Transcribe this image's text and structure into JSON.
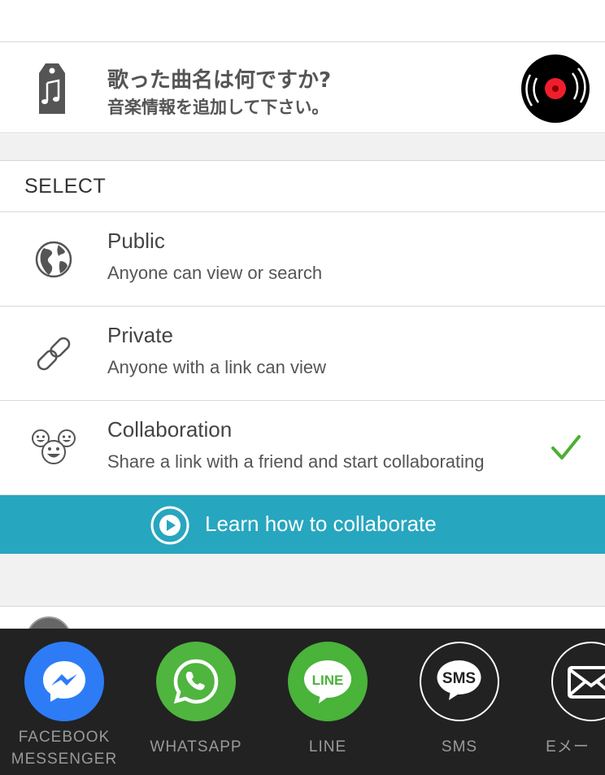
{
  "song": {
    "title": "歌った曲名は何ですか?",
    "subtitle": "音楽情報を追加して下さい。"
  },
  "select": {
    "label": "SELECT"
  },
  "options": [
    {
      "title": "Public",
      "description": "Anyone can view or search",
      "icon": "globe-icon",
      "selected": false
    },
    {
      "title": "Private",
      "description": "Anyone with a link can view",
      "icon": "link-icon",
      "selected": false
    },
    {
      "title": "Collaboration",
      "description": "Share a link with a friend and start collaborating",
      "icon": "smiley-group-icon",
      "selected": true
    }
  ],
  "learn": {
    "label": "Learn how to collaborate"
  },
  "share": {
    "items": [
      {
        "label_line1": "FACEBOOK",
        "label_line2": "MESSENGER",
        "icon": "messenger-icon",
        "color": "#2d7cf6"
      },
      {
        "label": "WHATSAPP",
        "icon": "whatsapp-icon",
        "color": "#4fb53f"
      },
      {
        "label": "LINE",
        "icon": "line-icon",
        "color": "#49b33a"
      },
      {
        "label": "SMS",
        "icon": "sms-icon",
        "color": "#222222"
      },
      {
        "label": "Eメー",
        "icon": "email-icon",
        "color": "#222222"
      }
    ]
  },
  "colors": {
    "accent_bar": "#27a6bf",
    "check": "#4caf32",
    "tray_bg": "#222222"
  }
}
